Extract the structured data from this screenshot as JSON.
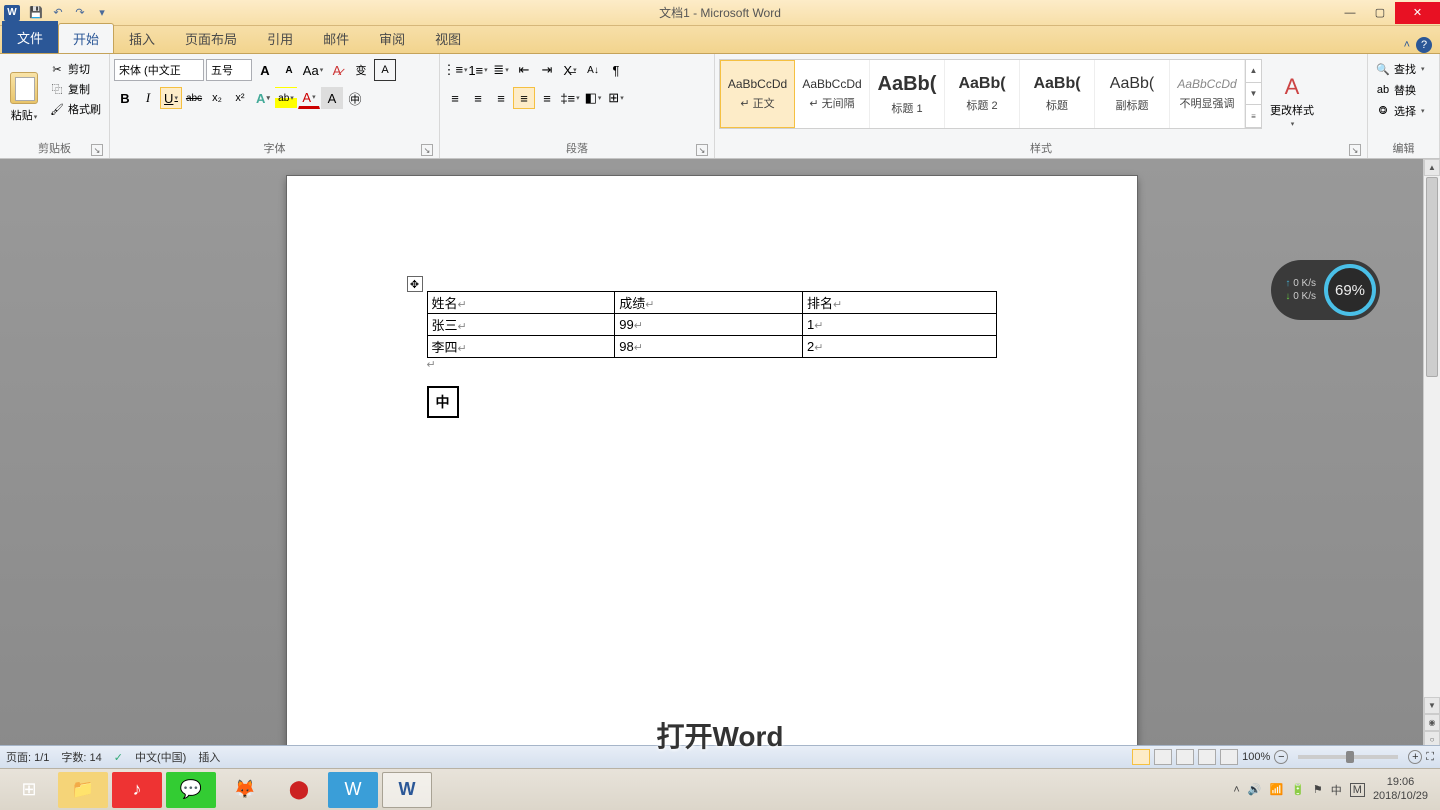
{
  "app": {
    "title": "文档1 - Microsoft Word",
    "icon_letter": "W"
  },
  "qat": {
    "save": "💾",
    "undo": "↶",
    "redo": "↷",
    "more": "▾"
  },
  "window": {
    "min": "—",
    "max": "▢",
    "close": "✕",
    "collapse": "˄",
    "help": "?"
  },
  "tabs": {
    "file": "文件",
    "home": "开始",
    "insert": "插入",
    "layout": "页面布局",
    "ref": "引用",
    "mail": "邮件",
    "review": "审阅",
    "view": "视图"
  },
  "clipboard": {
    "paste": "粘贴",
    "cut": "剪切",
    "copy": "复制",
    "format_painter": "格式刷",
    "label": "剪贴板"
  },
  "font": {
    "name": "宋体 (中文正",
    "size": "五号",
    "label": "字体",
    "grow": "A",
    "shrink": "A",
    "case": "Aa",
    "clear": "⌫",
    "phonetic": "变",
    "char_border": "A",
    "bold": "B",
    "italic": "I",
    "underline": "U",
    "strike": "abc",
    "sub": "x₂",
    "sup": "x²",
    "effects": "A",
    "highlight": "ab",
    "color": "A",
    "char_shade": "A",
    "enclose": "㊥"
  },
  "para": {
    "label": "段落",
    "bullets": "≡",
    "numbers": "≡",
    "multilevel": "≡",
    "dec_indent": "⇤",
    "inc_indent": "⇥",
    "asian": "X",
    "sort": "A↓",
    "marks": "¶",
    "align_l": "≡",
    "align_c": "≡",
    "align_r": "≡",
    "align_j": "≡",
    "distrib": "≡",
    "line_space": "⇅",
    "shading": "◧",
    "borders": "⊞"
  },
  "styles": {
    "label": "样式",
    "items": [
      {
        "preview": "AaBbCcDd",
        "name": "↵ 正文",
        "big": false
      },
      {
        "preview": "AaBbCcDd",
        "name": "↵ 无间隔",
        "big": false
      },
      {
        "preview": "AaBb(",
        "name": "标题 1",
        "big": true
      },
      {
        "preview": "AaBb(",
        "name": "标题 2",
        "big": false
      },
      {
        "preview": "AaBb(",
        "name": "标题",
        "big": false
      },
      {
        "preview": "AaBb(",
        "name": "副标题",
        "big": false
      },
      {
        "preview": "AaBbCcDd",
        "name": "不明显强调",
        "big": false
      }
    ],
    "change": "更改样式"
  },
  "editing": {
    "label": "编辑",
    "find": "查找",
    "replace": "替换",
    "select": "选择"
  },
  "table": {
    "header": [
      "姓名",
      "成绩",
      "排名"
    ],
    "rows": [
      [
        "张三",
        "99",
        "1"
      ],
      [
        "李四",
        "98",
        "2"
      ]
    ]
  },
  "ime": {
    "char": "中"
  },
  "caption": "打开Word",
  "status": {
    "page": "页面: 1/1",
    "words": "字数: 14",
    "lang": "中文(中国)",
    "mode": "插入",
    "zoom": "100%"
  },
  "netwidget": {
    "up": "0 K/s",
    "down": "0 K/s",
    "pct": "69%"
  },
  "tray": {
    "time": "19:06",
    "date": "2018/10/29"
  }
}
